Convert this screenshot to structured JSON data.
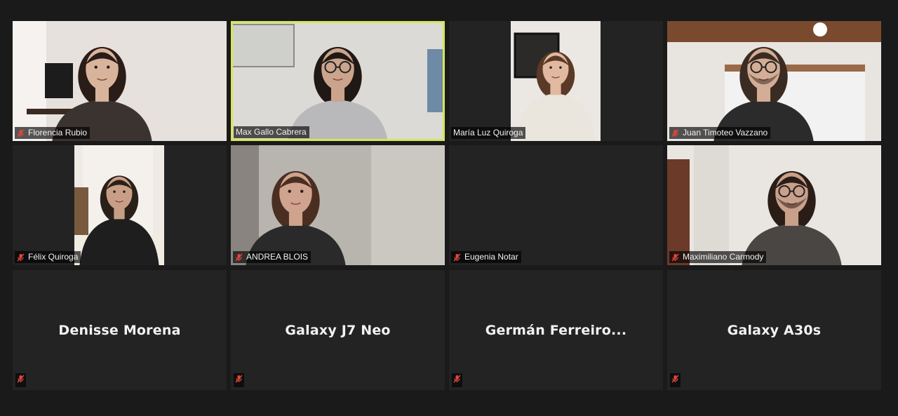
{
  "participants": [
    {
      "name": "Florencia Rubio",
      "muted": true,
      "video": true,
      "skin": "#d9b49c",
      "hair": "#2a1c16",
      "shirt": "#3a3330",
      "bg": "#e6e1dc",
      "accent": "#f5f2ef"
    },
    {
      "name": "Max Gallo Cabrera",
      "muted": false,
      "video": true,
      "active": true,
      "skin": "#caa48c",
      "hair": "#1f1814",
      "shirt": "#b9b9bb",
      "bg": "#dcdad6",
      "accent": "#ececea"
    },
    {
      "name": "María Luz Quiroga",
      "muted": false,
      "video": true,
      "skin": "#e0b9a0",
      "hair": "#5a3a26",
      "shirt": "#eae6de",
      "bg": "#ebe8e3",
      "accent": "#2c2a28"
    },
    {
      "name": "Juan Timoteo Vazzano",
      "muted": true,
      "video": true,
      "skin": "#d4ad96",
      "hair": "#3a2c22",
      "shirt": "#2b2b2b",
      "bg": "#e8e4df",
      "accent": "#7a4a2e"
    },
    {
      "name": "Félix Quiroga",
      "muted": true,
      "video": true,
      "skin": "#c89f86",
      "hair": "#2a201a",
      "shirt": "#1e1e1e",
      "bg": "#efeae4",
      "accent": "#8a6a4a"
    },
    {
      "name": "ANDREA BLOIS",
      "muted": true,
      "video": true,
      "skin": "#cfa38e",
      "hair": "#4a2e22",
      "shirt": "#2a2a2a",
      "bg": "#b8b4ae",
      "accent": "#d7d3cd"
    },
    {
      "name": "Eugenia Notar",
      "muted": true,
      "video": false,
      "blank": true
    },
    {
      "name": "Maximiliano Carmody",
      "muted": true,
      "video": true,
      "skin": "#c9a08a",
      "hair": "#2a1d18",
      "shirt": "#4a4644",
      "bg": "#e9e6e1",
      "accent": "#6b3a28"
    },
    {
      "name": "Denisse Morena",
      "muted": true,
      "video": false
    },
    {
      "name": "Galaxy J7 Neo",
      "muted": true,
      "video": false
    },
    {
      "name": "Germán  Ferreiro...",
      "muted": true,
      "video": false
    },
    {
      "name": "Galaxy A30s",
      "muted": true,
      "video": false
    }
  ],
  "icons": {
    "muted": "microphone-muted-icon"
  },
  "colors": {
    "active_border": "#d7e65a",
    "muted_red": "#e0463c",
    "tile_bg": "#232323"
  }
}
